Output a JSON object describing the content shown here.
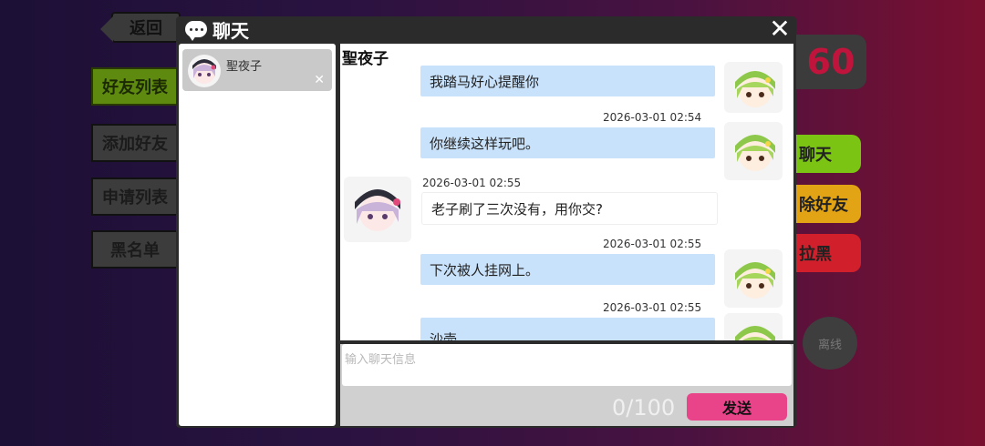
{
  "background": {
    "back_label": "返回",
    "menu": [
      {
        "label": "好友列表",
        "active": true
      },
      {
        "label": "添加好友",
        "active": false
      },
      {
        "label": "申请列表",
        "active": false
      },
      {
        "label": "黑名单",
        "active": false
      }
    ],
    "score": "60",
    "right_buttons": [
      {
        "label": "聊天",
        "color": "#7cc414"
      },
      {
        "label": "除好友",
        "color": "#e2a314"
      },
      {
        "label": "拉黑",
        "color": "#d1202c"
      }
    ],
    "offline_label": "离线"
  },
  "dialog": {
    "title": "聊天",
    "close_icon": "close-icon"
  },
  "friends": [
    {
      "name": "聖夜子",
      "remove_icon": "close-icon"
    }
  ],
  "chat": {
    "partner_name": "聖夜子",
    "messages": [
      {
        "sender": "self",
        "timestamp": "",
        "text": "我踏马好心提醒你"
      },
      {
        "sender": "self",
        "timestamp": "2026-03-01 02:54",
        "text": "你继续这样玩吧。"
      },
      {
        "sender": "other",
        "timestamp": "2026-03-01 02:55",
        "text": "老子刷了三次没有，用你交?"
      },
      {
        "sender": "self",
        "timestamp": "2026-03-01 02:55",
        "text": "下次被人挂网上。"
      },
      {
        "sender": "self",
        "timestamp": "2026-03-01 02:55",
        "text": "沙壶"
      }
    ]
  },
  "input": {
    "placeholder": "输入聊天信息",
    "value": "",
    "counter": "0/100",
    "send_label": "发送"
  },
  "colors": {
    "self_bubble": "#c9e2fb",
    "send_button": "#e9438a",
    "dialog_bg": "#2b2b2b"
  }
}
